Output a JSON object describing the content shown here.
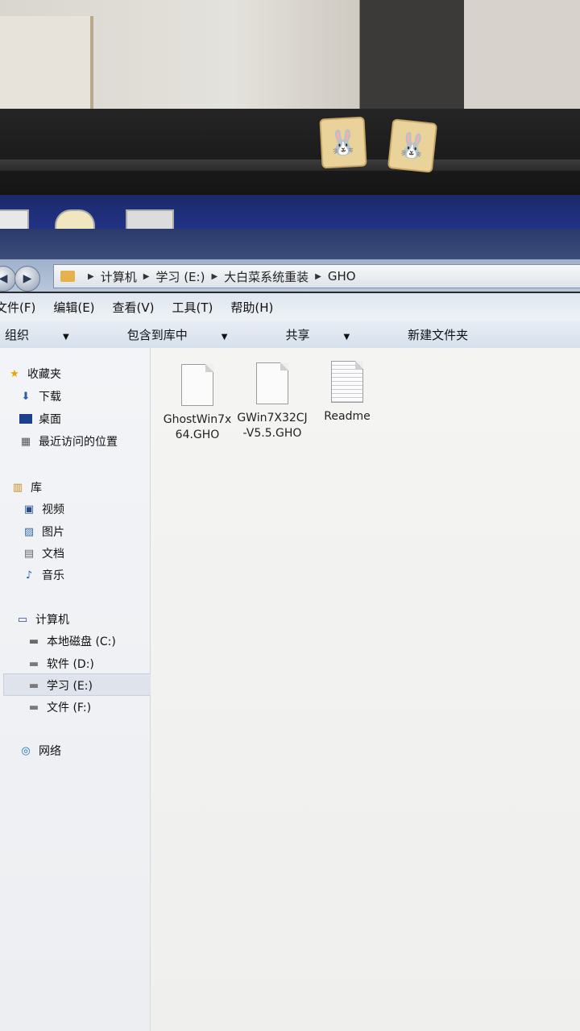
{
  "address": {
    "crumbs": [
      "计算机",
      "学习 (E:)",
      "大白菜系统重装",
      "GHO"
    ]
  },
  "menu": [
    "文件(F)",
    "编辑(E)",
    "查看(V)",
    "工具(T)",
    "帮助(H)"
  ],
  "toolbar": [
    "组织",
    "包含到库中",
    "共享",
    "新建文件夹"
  ],
  "sidebar": {
    "favorites": {
      "label": "收藏夹",
      "items": [
        "下载",
        "桌面",
        "最近访问的位置"
      ]
    },
    "libraries": {
      "label": "库",
      "items": [
        "视频",
        "图片",
        "文档",
        "音乐"
      ]
    },
    "computer": {
      "label": "计算机",
      "items": [
        "本地磁盘 (C:)",
        "软件 (D:)",
        "学习 (E:)",
        "文件 (F:)"
      ]
    },
    "network": {
      "label": "网络"
    }
  },
  "files": [
    {
      "name": "GhostWin7x64.GHO",
      "icon": "blank-file-icon"
    },
    {
      "name": "GWin7X32CJ-V5.5.GHO",
      "icon": "blank-file-icon"
    },
    {
      "name": "Readme",
      "icon": "text-file-icon"
    }
  ],
  "colors": {
    "accent": "#2a3a6a",
    "selection": "#dfe4ec",
    "folder": "#e7b24c"
  }
}
